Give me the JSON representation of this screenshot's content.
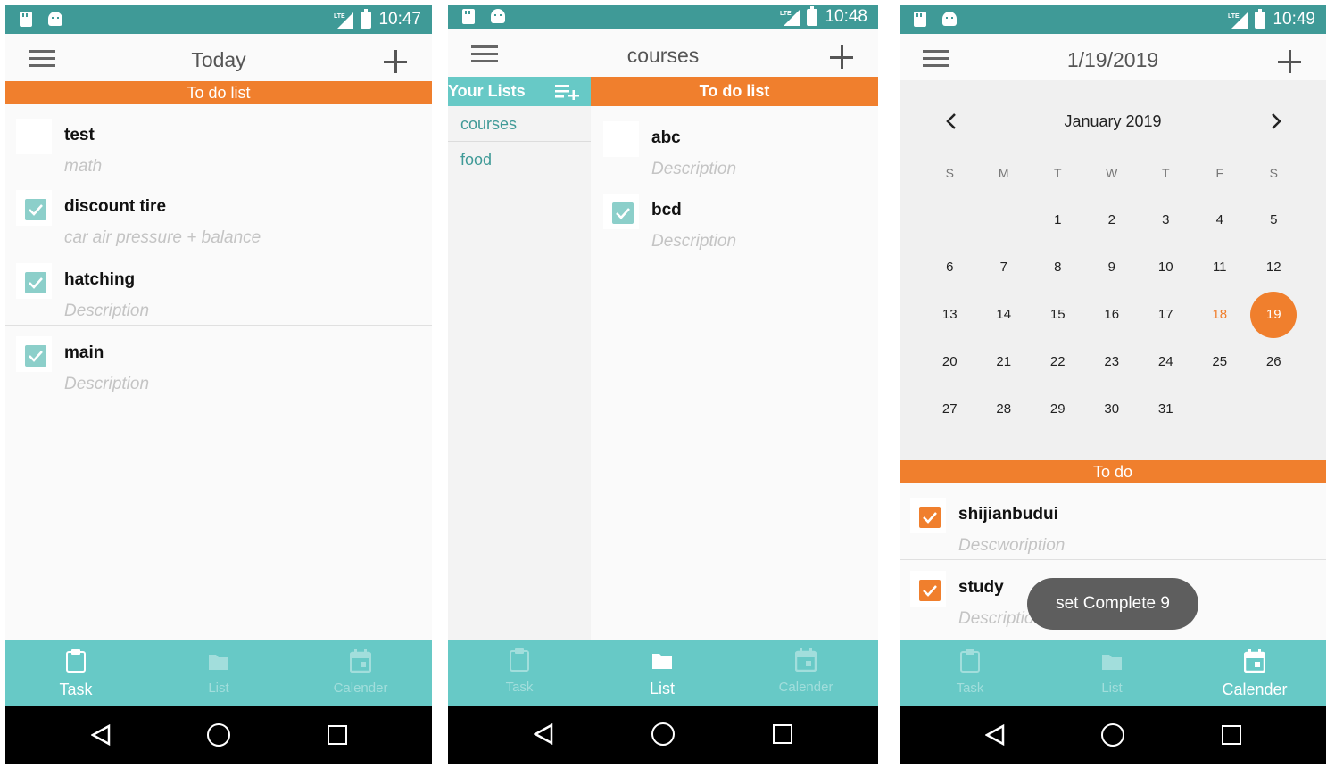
{
  "colors": {
    "statusbar": "#3f9a97",
    "accent_orange": "#f07f2d",
    "nav_teal": "#67c9c6",
    "check_teal": "#8ccfca"
  },
  "icons": [
    "sd-card-icon",
    "android-icon",
    "lte-signal-icon",
    "battery-icon",
    "menu-icon",
    "plus-icon",
    "checkbox-check-icon",
    "clipboard-icon",
    "folder-icon",
    "calendar-icon",
    "back-icon",
    "home-icon",
    "recents-icon",
    "playlist-add-icon",
    "chevron-left-icon",
    "chevron-right-icon"
  ],
  "screens": [
    {
      "status": {
        "time": "10:47",
        "network": "LTE"
      },
      "appbar": {
        "title": "Today"
      },
      "section_label": "To do list",
      "tasks": [
        {
          "title": "test",
          "desc": "math",
          "checked": false
        },
        {
          "title": "discount tire",
          "desc": "car air pressure + balance",
          "checked": true
        },
        {
          "title": "hatching",
          "desc": "Description",
          "checked": true
        },
        {
          "title": "main",
          "desc": "Description",
          "checked": true
        }
      ],
      "nav": {
        "task": "Task",
        "list": "List",
        "calender": "Calender",
        "active": "Task"
      }
    },
    {
      "status": {
        "time": "10:48",
        "network": "LTE"
      },
      "appbar": {
        "title": "courses"
      },
      "side_header": "Your Lists",
      "lists": [
        "courses",
        "food"
      ],
      "section_label": "To do list",
      "tasks": [
        {
          "title": "abc",
          "desc": "Description",
          "checked": false
        },
        {
          "title": "bcd",
          "desc": "Description",
          "checked": true
        }
      ],
      "nav": {
        "task": "Task",
        "list": "List",
        "calender": "Calender",
        "active": "List"
      }
    },
    {
      "status": {
        "time": "10:49",
        "network": "LTE"
      },
      "appbar": {
        "title": "1/19/2019"
      },
      "calendar": {
        "month": "January 2019",
        "weekdays": [
          "S",
          "M",
          "T",
          "W",
          "T",
          "F",
          "S"
        ],
        "weeks": [
          [
            "",
            "",
            "1",
            "2",
            "3",
            "4",
            "5"
          ],
          [
            "6",
            "7",
            "8",
            "9",
            "10",
            "11",
            "12"
          ],
          [
            "13",
            "14",
            "15",
            "16",
            "17",
            "18",
            "19"
          ],
          [
            "20",
            "21",
            "22",
            "23",
            "24",
            "25",
            "26"
          ],
          [
            "27",
            "28",
            "29",
            "30",
            "31",
            "",
            ""
          ]
        ],
        "today": "18",
        "selected": "19"
      },
      "section_label": "To do",
      "tasks": [
        {
          "title": "shijianbudui",
          "desc": "Descwoription",
          "checked": true
        },
        {
          "title": "study",
          "desc": "Description",
          "checked": true
        }
      ],
      "toast": "set Complete 9",
      "nav": {
        "task": "Task",
        "list": "List",
        "calender": "Calender",
        "active": "Calender"
      }
    }
  ]
}
